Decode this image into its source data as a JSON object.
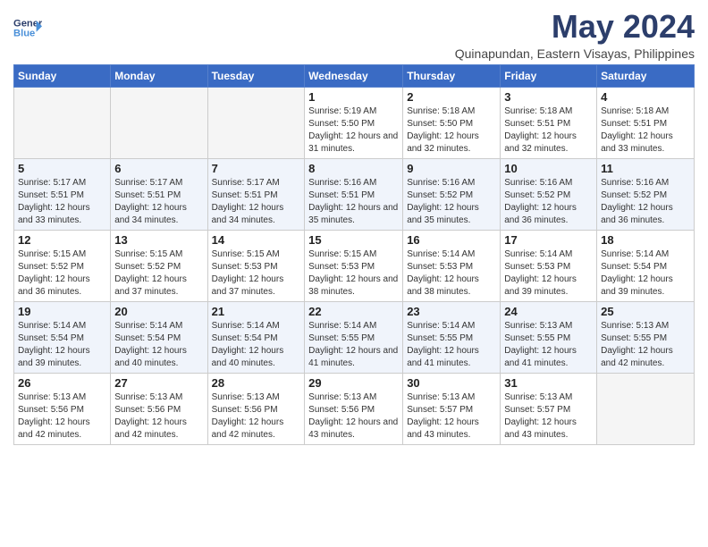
{
  "header": {
    "logo_line1": "General",
    "logo_line2": "Blue",
    "month_year": "May 2024",
    "location": "Quinapundan, Eastern Visayas, Philippines"
  },
  "days_of_week": [
    "Sunday",
    "Monday",
    "Tuesday",
    "Wednesday",
    "Thursday",
    "Friday",
    "Saturday"
  ],
  "weeks": [
    [
      {
        "day": "",
        "empty": true
      },
      {
        "day": "",
        "empty": true
      },
      {
        "day": "",
        "empty": true
      },
      {
        "day": "1",
        "sunrise": "5:19 AM",
        "sunset": "5:50 PM",
        "daylight": "12 hours and 31 minutes."
      },
      {
        "day": "2",
        "sunrise": "5:18 AM",
        "sunset": "5:50 PM",
        "daylight": "12 hours and 32 minutes."
      },
      {
        "day": "3",
        "sunrise": "5:18 AM",
        "sunset": "5:51 PM",
        "daylight": "12 hours and 32 minutes."
      },
      {
        "day": "4",
        "sunrise": "5:18 AM",
        "sunset": "5:51 PM",
        "daylight": "12 hours and 33 minutes."
      }
    ],
    [
      {
        "day": "5",
        "sunrise": "5:17 AM",
        "sunset": "5:51 PM",
        "daylight": "12 hours and 33 minutes."
      },
      {
        "day": "6",
        "sunrise": "5:17 AM",
        "sunset": "5:51 PM",
        "daylight": "12 hours and 34 minutes."
      },
      {
        "day": "7",
        "sunrise": "5:17 AM",
        "sunset": "5:51 PM",
        "daylight": "12 hours and 34 minutes."
      },
      {
        "day": "8",
        "sunrise": "5:16 AM",
        "sunset": "5:51 PM",
        "daylight": "12 hours and 35 minutes."
      },
      {
        "day": "9",
        "sunrise": "5:16 AM",
        "sunset": "5:52 PM",
        "daylight": "12 hours and 35 minutes."
      },
      {
        "day": "10",
        "sunrise": "5:16 AM",
        "sunset": "5:52 PM",
        "daylight": "12 hours and 36 minutes."
      },
      {
        "day": "11",
        "sunrise": "5:16 AM",
        "sunset": "5:52 PM",
        "daylight": "12 hours and 36 minutes."
      }
    ],
    [
      {
        "day": "12",
        "sunrise": "5:15 AM",
        "sunset": "5:52 PM",
        "daylight": "12 hours and 36 minutes."
      },
      {
        "day": "13",
        "sunrise": "5:15 AM",
        "sunset": "5:52 PM",
        "daylight": "12 hours and 37 minutes."
      },
      {
        "day": "14",
        "sunrise": "5:15 AM",
        "sunset": "5:53 PM",
        "daylight": "12 hours and 37 minutes."
      },
      {
        "day": "15",
        "sunrise": "5:15 AM",
        "sunset": "5:53 PM",
        "daylight": "12 hours and 38 minutes."
      },
      {
        "day": "16",
        "sunrise": "5:14 AM",
        "sunset": "5:53 PM",
        "daylight": "12 hours and 38 minutes."
      },
      {
        "day": "17",
        "sunrise": "5:14 AM",
        "sunset": "5:53 PM",
        "daylight": "12 hours and 39 minutes."
      },
      {
        "day": "18",
        "sunrise": "5:14 AM",
        "sunset": "5:54 PM",
        "daylight": "12 hours and 39 minutes."
      }
    ],
    [
      {
        "day": "19",
        "sunrise": "5:14 AM",
        "sunset": "5:54 PM",
        "daylight": "12 hours and 39 minutes."
      },
      {
        "day": "20",
        "sunrise": "5:14 AM",
        "sunset": "5:54 PM",
        "daylight": "12 hours and 40 minutes."
      },
      {
        "day": "21",
        "sunrise": "5:14 AM",
        "sunset": "5:54 PM",
        "daylight": "12 hours and 40 minutes."
      },
      {
        "day": "22",
        "sunrise": "5:14 AM",
        "sunset": "5:55 PM",
        "daylight": "12 hours and 41 minutes."
      },
      {
        "day": "23",
        "sunrise": "5:14 AM",
        "sunset": "5:55 PM",
        "daylight": "12 hours and 41 minutes."
      },
      {
        "day": "24",
        "sunrise": "5:13 AM",
        "sunset": "5:55 PM",
        "daylight": "12 hours and 41 minutes."
      },
      {
        "day": "25",
        "sunrise": "5:13 AM",
        "sunset": "5:55 PM",
        "daylight": "12 hours and 42 minutes."
      }
    ],
    [
      {
        "day": "26",
        "sunrise": "5:13 AM",
        "sunset": "5:56 PM",
        "daylight": "12 hours and 42 minutes."
      },
      {
        "day": "27",
        "sunrise": "5:13 AM",
        "sunset": "5:56 PM",
        "daylight": "12 hours and 42 minutes."
      },
      {
        "day": "28",
        "sunrise": "5:13 AM",
        "sunset": "5:56 PM",
        "daylight": "12 hours and 42 minutes."
      },
      {
        "day": "29",
        "sunrise": "5:13 AM",
        "sunset": "5:56 PM",
        "daylight": "12 hours and 43 minutes."
      },
      {
        "day": "30",
        "sunrise": "5:13 AM",
        "sunset": "5:57 PM",
        "daylight": "12 hours and 43 minutes."
      },
      {
        "day": "31",
        "sunrise": "5:13 AM",
        "sunset": "5:57 PM",
        "daylight": "12 hours and 43 minutes."
      },
      {
        "day": "",
        "empty": true
      }
    ]
  ],
  "labels": {
    "sunrise": "Sunrise:",
    "sunset": "Sunset:",
    "daylight": "Daylight:"
  }
}
